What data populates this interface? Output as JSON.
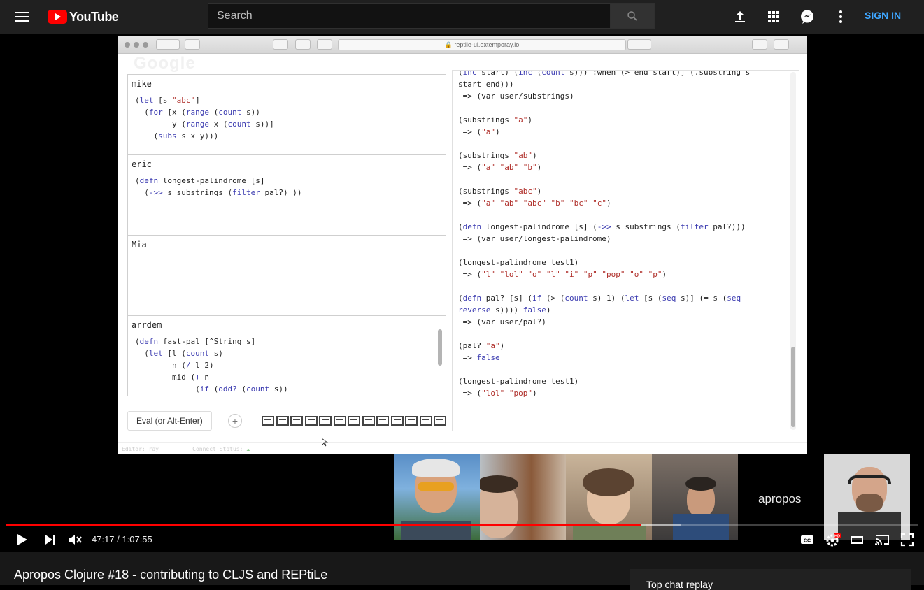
{
  "header": {
    "logo_text": "YouTube",
    "search_placeholder": "Search",
    "signin_label": "SIGN IN"
  },
  "browser": {
    "url": "reptile-ui.extemporay.io",
    "ghost_logo": "Google"
  },
  "cells": [
    {
      "author": "mike",
      "code": [
        [
          [
            "(",
            ""
          ],
          [
            "let",
            "kw"
          ],
          [
            " [s ",
            ""
          ],
          [
            "\"abc\"",
            "st"
          ],
          [
            "]",
            ""
          ]
        ],
        [
          [
            "  (",
            ""
          ],
          [
            "for",
            "kw"
          ],
          [
            " [x (",
            ""
          ],
          [
            "range",
            "kw"
          ],
          [
            " (",
            ""
          ],
          [
            "count",
            "kw"
          ],
          [
            " s))",
            ""
          ]
        ],
        [
          [
            "        y (",
            ""
          ],
          [
            "range",
            "kw"
          ],
          [
            " x (",
            ""
          ],
          [
            "count",
            "kw"
          ],
          [
            " s))]",
            ""
          ]
        ],
        [
          [
            "    (",
            ""
          ],
          [
            "subs",
            "kw"
          ],
          [
            " s x y)))",
            ""
          ]
        ]
      ]
    },
    {
      "author": "eric",
      "code": [
        [
          [
            "(",
            ""
          ],
          [
            "defn",
            "kw"
          ],
          [
            " longest-palindrome [s]",
            ""
          ]
        ],
        [
          [
            "  (",
            ""
          ],
          [
            "->>",
            "kw"
          ],
          [
            " s substrings (",
            ""
          ],
          [
            "filter",
            "kw"
          ],
          [
            " pal?) ))",
            ""
          ]
        ]
      ]
    },
    {
      "author": "Mia",
      "code": []
    },
    {
      "author": "arrdem",
      "code": [
        [
          [
            "(",
            ""
          ],
          [
            "defn",
            "kw"
          ],
          [
            " fast-pal [^String s]",
            ""
          ]
        ],
        [
          [
            "  (",
            ""
          ],
          [
            "let",
            "kw"
          ],
          [
            " [l (",
            ""
          ],
          [
            "count",
            "kw"
          ],
          [
            " s)",
            ""
          ]
        ],
        [
          [
            "        n (",
            ""
          ],
          [
            "/",
            "kw"
          ],
          [
            " l 2)",
            ""
          ]
        ],
        [
          [
            "        mid (",
            ""
          ],
          [
            "+",
            "kw"
          ],
          [
            " n",
            ""
          ]
        ],
        [
          [
            "             (",
            ""
          ],
          [
            "if",
            "kw"
          ],
          [
            " (",
            ""
          ],
          [
            "odd?",
            "kw"
          ],
          [
            " (",
            ""
          ],
          [
            "count",
            "kw"
          ],
          [
            " s))",
            ""
          ]
        ]
      ]
    }
  ],
  "repl": [
    [
      [
        "(",
        ""
      ],
      [
        "inc",
        "kw"
      ],
      [
        " start) (",
        ""
      ],
      [
        "inc",
        "kw"
      ],
      [
        " (",
        ""
      ],
      [
        "count",
        "kw"
      ],
      [
        " s))) :when (> end start)] (.substring s",
        ""
      ]
    ],
    [
      [
        "start end)))",
        ""
      ]
    ],
    [
      [
        " => (var user/substrings)",
        ""
      ]
    ],
    [
      [
        "",
        ""
      ]
    ],
    [
      [
        "(substrings ",
        ""
      ],
      [
        "\"a\"",
        "st"
      ],
      [
        ")",
        ""
      ]
    ],
    [
      [
        " => (",
        ""
      ],
      [
        "\"a\"",
        "st"
      ],
      [
        ")",
        ""
      ]
    ],
    [
      [
        "",
        ""
      ]
    ],
    [
      [
        "(substrings ",
        ""
      ],
      [
        "\"ab\"",
        "st"
      ],
      [
        ")",
        ""
      ]
    ],
    [
      [
        " => (",
        ""
      ],
      [
        "\"a\"",
        "st"
      ],
      [
        " ",
        ""
      ],
      [
        "\"ab\"",
        "st"
      ],
      [
        " ",
        ""
      ],
      [
        "\"b\"",
        "st"
      ],
      [
        ")",
        ""
      ]
    ],
    [
      [
        "",
        ""
      ]
    ],
    [
      [
        "(substrings ",
        ""
      ],
      [
        "\"abc\"",
        "st"
      ],
      [
        ")",
        ""
      ]
    ],
    [
      [
        " => (",
        ""
      ],
      [
        "\"a\"",
        "st"
      ],
      [
        " ",
        ""
      ],
      [
        "\"ab\"",
        "st"
      ],
      [
        " ",
        ""
      ],
      [
        "\"abc\"",
        "st"
      ],
      [
        " ",
        ""
      ],
      [
        "\"b\"",
        "st"
      ],
      [
        " ",
        ""
      ],
      [
        "\"bc\"",
        "st"
      ],
      [
        " ",
        ""
      ],
      [
        "\"c\"",
        "st"
      ],
      [
        ")",
        ""
      ]
    ],
    [
      [
        "",
        ""
      ]
    ],
    [
      [
        "(",
        ""
      ],
      [
        "defn",
        "kw"
      ],
      [
        " longest-palindrome [s] (",
        ""
      ],
      [
        "->>",
        "kw"
      ],
      [
        " s substrings (",
        ""
      ],
      [
        "filter",
        "kw"
      ],
      [
        " pal?)))",
        ""
      ]
    ],
    [
      [
        " => (var user/longest-palindrome)",
        ""
      ]
    ],
    [
      [
        "",
        ""
      ]
    ],
    [
      [
        "(longest-palindrome test1)",
        ""
      ]
    ],
    [
      [
        " => (",
        ""
      ],
      [
        "\"l\"",
        "st"
      ],
      [
        " ",
        ""
      ],
      [
        "\"lol\"",
        "st"
      ],
      [
        " ",
        ""
      ],
      [
        "\"o\"",
        "st"
      ],
      [
        " ",
        ""
      ],
      [
        "\"l\"",
        "st"
      ],
      [
        " ",
        ""
      ],
      [
        "\"i\"",
        "st"
      ],
      [
        " ",
        ""
      ],
      [
        "\"p\"",
        "st"
      ],
      [
        " ",
        ""
      ],
      [
        "\"pop\"",
        "st"
      ],
      [
        " ",
        ""
      ],
      [
        "\"o\"",
        "st"
      ],
      [
        " ",
        ""
      ],
      [
        "\"p\"",
        "st"
      ],
      [
        ")",
        ""
      ]
    ],
    [
      [
        "",
        ""
      ]
    ],
    [
      [
        "(",
        ""
      ],
      [
        "defn",
        "kw"
      ],
      [
        " pal? [s] (",
        ""
      ],
      [
        "if",
        "kw"
      ],
      [
        " (> (",
        ""
      ],
      [
        "count",
        "kw"
      ],
      [
        " s) 1) (",
        ""
      ],
      [
        "let",
        "kw"
      ],
      [
        " [s (",
        ""
      ],
      [
        "seq",
        "kw"
      ],
      [
        " s)] (= s (",
        ""
      ],
      [
        "seq",
        "kw"
      ],
      [
        "",
        ""
      ]
    ],
    [
      [
        "reverse",
        "kw"
      ],
      [
        " s)))) ",
        ""
      ],
      [
        "false",
        "kw"
      ],
      [
        ")",
        ""
      ]
    ],
    [
      [
        " => (var user/pal?)",
        ""
      ]
    ],
    [
      [
        "",
        ""
      ]
    ],
    [
      [
        "(pal? ",
        ""
      ],
      [
        "\"a\"",
        "st"
      ],
      [
        ")",
        ""
      ]
    ],
    [
      [
        " => ",
        ""
      ],
      [
        "false",
        "kw"
      ]
    ],
    [
      [
        "",
        ""
      ]
    ],
    [
      [
        "(longest-palindrome test1)",
        ""
      ]
    ],
    [
      [
        " => (",
        ""
      ],
      [
        "\"lol\"",
        "st"
      ],
      [
        " ",
        ""
      ],
      [
        "\"pop\"",
        "st"
      ],
      [
        ")",
        ""
      ]
    ]
  ],
  "editor": {
    "eval_label": "Eval (or Alt-Enter)",
    "add_label": "+",
    "chat_icon_count": 13,
    "status_editor": "Editor: ray",
    "status_connect": "Connect Status:"
  },
  "stream": {
    "label": "apropos"
  },
  "player": {
    "time_current": "47:17",
    "time_separator": " / ",
    "time_total": "1:07:55",
    "played_fraction": 0.696,
    "loaded_fraction": 0.74
  },
  "video": {
    "title": "Apropos Clojure #18 - contributing to CLJS and REPtiLe"
  },
  "chat": {
    "label": "Top chat replay"
  },
  "colors": {
    "accent_red": "#ff0000",
    "signin_blue": "#3ea6ff",
    "keyword": "#3b3bb0",
    "string": "#b0302b"
  }
}
